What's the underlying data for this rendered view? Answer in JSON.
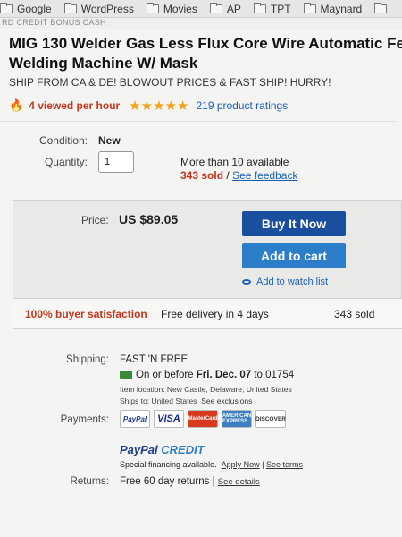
{
  "bookmarks": [
    {
      "label": "Google"
    },
    {
      "label": "WordPress"
    },
    {
      "label": "Movies"
    },
    {
      "label": "AP"
    },
    {
      "label": "TPT"
    },
    {
      "label": "Maynard"
    }
  ],
  "banner_strip": "RD CREDIT BONUS CASH",
  "listing": {
    "title_line1": "MIG 130 Welder Gas Less Flux Core Wire Automatic Fe",
    "title_line2": "Welding Machine W/ Mask",
    "subtitle": "SHIP FROM CA & DE! BLOWOUT PRICES & FAST SHIP! HURRY!",
    "viewed": "4 viewed per hour",
    "stars": "★★★★★",
    "ratings": "219 product ratings"
  },
  "details": {
    "condition_label": "Condition:",
    "condition_value": "New",
    "quantity_label": "Quantity:",
    "quantity_value": "1",
    "available": "More than 10 available",
    "sold": "343 sold",
    "separator": "/",
    "feedback": "See feedback"
  },
  "buybox": {
    "price_label": "Price:",
    "price": "US $89.05",
    "buy_now": "Buy It Now",
    "add_to_cart": "Add to cart",
    "watch": "Add to watch list",
    "satisfaction": "100% buyer satisfaction",
    "delivery": "Free delivery in 4 days",
    "sold": "343 sold"
  },
  "shipping": {
    "label": "Shipping:",
    "method": "FAST 'N FREE",
    "eta_prefix": "On or before",
    "eta_date": "Fri. Dec. 07",
    "eta_suffix": "to 01754",
    "location": "Item location:  New Castle, Delaware, United States",
    "ships_to": "Ships to:  United States",
    "exclusions": "See exclusions"
  },
  "payments": {
    "label": "Payments:",
    "cards": [
      "PayPal",
      "VISA",
      "MasterCard",
      "AMERICAN EXPRESS",
      "DISCOVER"
    ],
    "credit_brand_1": "PayPal",
    "credit_brand_2": "CREDIT",
    "financing": "Special financing available.",
    "apply": "Apply Now",
    "sep": "|",
    "terms": "See terms"
  },
  "returns": {
    "label": "Returns:",
    "value": "Free 60 day returns",
    "sep": "|",
    "details": "See details"
  },
  "colors": {
    "link": "#1a5fb4",
    "buy_button": "#1a4fa0",
    "cart_button": "#2b7ec7",
    "accent_red": "#c7361c",
    "star": "#f0a31b"
  }
}
